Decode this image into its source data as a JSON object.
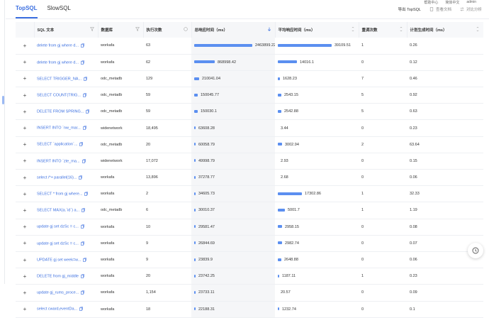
{
  "top_menu": [
    "帮助中心",
    "简体中文",
    "admin"
  ],
  "tabs": [
    {
      "label": "TopSQL",
      "active": true
    },
    {
      "label": "SlowSQL",
      "active": false
    }
  ],
  "actions": {
    "export_label": "导出 TopSQL",
    "doc_label": "查看文档",
    "compare_label": "对比分析"
  },
  "columns": {
    "sql": "SQL 文本",
    "db": "数据库",
    "exec": "执行次数",
    "total": "总响应时间（ms）",
    "avg": "平均响应时间（ms）",
    "retry": "重调次数",
    "plan": "计划生成时间（ms）"
  },
  "max_total": 2463899.22,
  "max_avg": 39109.51,
  "rows": [
    {
      "sql": "delete from gj where d...",
      "db": "workafa",
      "exec": "63",
      "total": "2463899.22",
      "total_v": 2463899.22,
      "avg": "39109.51",
      "avg_v": 39109.51,
      "retry": "1",
      "plan": "0.26"
    },
    {
      "sql": "delete from gj where d...",
      "db": "workafa",
      "exec": "62",
      "total": "868998.42",
      "total_v": 868998.42,
      "avg": "14016.1",
      "avg_v": 14016.1,
      "retry": "0",
      "plan": "0.12"
    },
    {
      "sql": "SELECT TRIGGER_NA...",
      "db": "odc_metadb",
      "exec": "129",
      "total": "210041.04",
      "total_v": 210041.04,
      "avg": "1628.23",
      "avg_v": 1628.23,
      "retry": "7",
      "plan": "0.46"
    },
    {
      "sql": "SELECT COUNT(TRIG...",
      "db": "odc_metadb",
      "exec": "59",
      "total": "150045.77",
      "total_v": 150045.77,
      "avg": "2543.15",
      "avg_v": 2543.15,
      "retry": "5",
      "plan": "0.92"
    },
    {
      "sql": "DELETE FROM SPRING...",
      "db": "odc_metadb",
      "exec": "59",
      "total": "150030.1",
      "total_v": 150030.1,
      "avg": "2542.88",
      "avg_v": 2542.88,
      "retry": "5",
      "plan": "0.63"
    },
    {
      "sql": "INSERT INTO `nw_mar...",
      "db": "widenetwork",
      "exec": "18,495",
      "total": "63608.28",
      "total_v": 63608.28,
      "avg": "3.44",
      "avg_v": 3.44,
      "retry": "0",
      "plan": "0.23"
    },
    {
      "sql": "SELECT `application`...",
      "db": "odc_metadb",
      "exec": "20",
      "total": "60058.79",
      "total_v": 60058.79,
      "avg": "3002.94",
      "avg_v": 3002.94,
      "retry": "2",
      "plan": "63.64"
    },
    {
      "sql": "INSERT INTO `zte_ma...",
      "db": "widenetwork",
      "exec": "17,072",
      "total": "49998.79",
      "total_v": 49998.79,
      "avg": "2.93",
      "avg_v": 2.93,
      "retry": "0",
      "plan": "0.15"
    },
    {
      "sql": "select /*+ parallel(16)...",
      "db": "workafa",
      "exec": "13,896",
      "total": "37278.77",
      "total_v": 37278.77,
      "avg": "2.68",
      "avg_v": 2.68,
      "retry": "0",
      "plan": "0.06"
    },
    {
      "sql": "SELECT * from gj where...",
      "db": "workafa",
      "exec": "2",
      "total": "34605.73",
      "total_v": 34605.73,
      "avg": "17302.86",
      "avg_v": 17302.86,
      "retry": "1",
      "plan": "32.33"
    },
    {
      "sql": "SELECT MAX(a.`id`) a...",
      "db": "odc_metadb",
      "exec": "6",
      "total": "30010.37",
      "total_v": 30010.37,
      "avg": "5001.7",
      "avg_v": 5001.7,
      "retry": "1",
      "plan": "1.19"
    },
    {
      "sql": "update gj set dzSc = c...",
      "db": "workafa",
      "exec": "10",
      "total": "29581.47",
      "total_v": 29581.47,
      "avg": "2958.15",
      "avg_v": 2958.15,
      "retry": "0",
      "plan": "0.08"
    },
    {
      "sql": "update gj set dzSc = c...",
      "db": "workafa",
      "exec": "9",
      "total": "26844.69",
      "total_v": 26844.69,
      "avg": "2982.74",
      "avg_v": 2982.74,
      "retry": "0",
      "plan": "0.07"
    },
    {
      "sql": "UPDATE gj set week=w...",
      "db": "workafa",
      "exec": "9",
      "total": "23839.9",
      "total_v": 23839.9,
      "avg": "2648.88",
      "avg_v": 2648.88,
      "retry": "0",
      "plan": "0.06"
    },
    {
      "sql": "DELETE from gj_middle",
      "db": "workafa",
      "exec": "20",
      "total": "23742.25",
      "total_v": 23742.25,
      "avg": "1187.11",
      "avg_v": 1187.11,
      "retry": "1",
      "plan": "0.23"
    },
    {
      "sql": "update gj_rums_proce...",
      "db": "workafa",
      "exec": "1,154",
      "total": "23733.11",
      "total_v": 23733.11,
      "avg": "20.57",
      "avg_v": 20.57,
      "retry": "0",
      "plan": "0.09"
    },
    {
      "sql": "select cward,eventDa...",
      "db": "workafa",
      "exec": "18",
      "total": "22188.31",
      "total_v": 22188.31,
      "avg": "1232.74",
      "avg_v": 1232.74,
      "retry": "0",
      "plan": "0.1"
    }
  ],
  "colors": {
    "accent": "#3b6fe0",
    "bar": "#5b8ff0"
  }
}
